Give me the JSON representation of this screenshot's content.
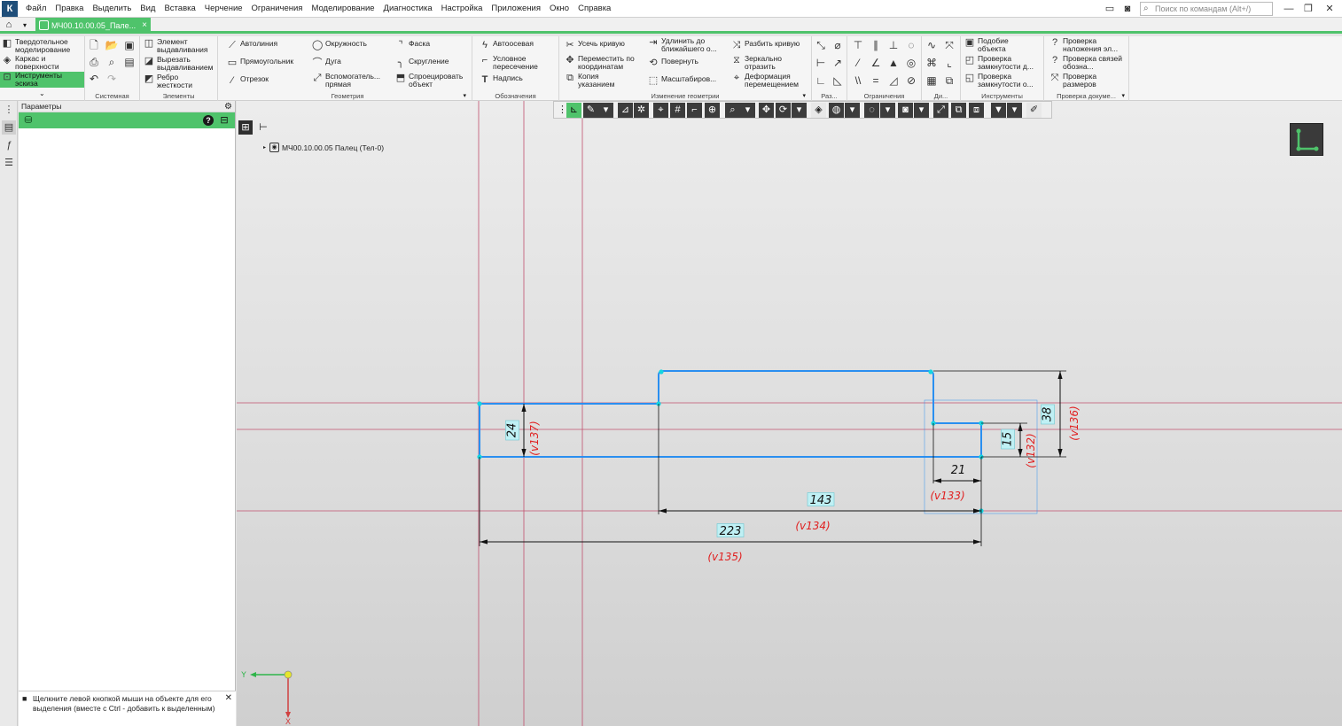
{
  "menu": {
    "logo": "К",
    "items": [
      "Файл",
      "Правка",
      "Выделить",
      "Вид",
      "Вставка",
      "Черчение",
      "Ограничения",
      "Моделирование",
      "Диагностика",
      "Настройка",
      "Приложения",
      "Окно",
      "Справка"
    ],
    "search_placeholder": "Поиск по командам (Alt+/)"
  },
  "tabs": {
    "doc_label": "МЧ00.10.00.05_Пале...",
    "close": "×"
  },
  "ribbon": {
    "left_modes": [
      "Твердотельное моделирование",
      "Каркас и поверхности",
      "Инструменты эскиза"
    ],
    "groups": {
      "system": "Системная",
      "elements": "Элементы",
      "geometry": "Геометрия",
      "designations": "Обозначения",
      "edit_geometry": "Изменение геометрии",
      "dimensions": "Раз...",
      "constraints": "Ограничения",
      "di": "Ди...",
      "tools": "Инструменты",
      "check_doc": "Проверка докуме..."
    },
    "elements": [
      "Элемент выдавливания",
      "Вырезать выдавливанием",
      "Ребро жесткости"
    ],
    "geometry": [
      "Автолиния",
      "Окружность",
      "Фаска",
      "Прямоугольник",
      "Дуга",
      "Скругление",
      "Отрезок",
      "Вспомогатель... прямая",
      "Спроецировать объект"
    ],
    "designations": [
      "Автоосевая",
      "Условное пересечение",
      "Надпись"
    ],
    "edit_geometry": [
      "Усечь кривую",
      "Удлинить до ближайшего о...",
      "Разбить кривую",
      "Переместить по координатам",
      "Повернуть",
      "Зеркально отразить",
      "Копия указанием",
      "Масштабиров...",
      "Деформация перемещением"
    ],
    "tools": [
      "Подобие объекта",
      "Проверка замкнутости д...",
      "Проверка замкнутости о..."
    ],
    "check_doc": [
      "Проверка наложения эл...",
      "Проверка связей обозна...",
      "Проверка размеров"
    ]
  },
  "panel": {
    "title": "Параметры",
    "help": "?",
    "hint": "Щелкните левой кнопкой мыши на объекте для его выделения (вместе с Ctrl - добавить к выделенным)"
  },
  "tree": {
    "root": "МЧ00.10.00.05 Палец (Тел-0)"
  },
  "sketch": {
    "dimensions": [
      {
        "value": "24",
        "var": "(v137)"
      },
      {
        "value": "38",
        "var": "(v136)"
      },
      {
        "value": "15",
        "var": "(v132)"
      },
      {
        "value": "21",
        "var": "(v133)"
      },
      {
        "value": "143",
        "var": "(v134)"
      },
      {
        "value": "223",
        "var": "(v135)"
      }
    ],
    "axis_x": "X",
    "axis_y": "Y",
    "colors": {
      "contour": "#2a8ff0",
      "axes": "#c0506e",
      "dim": "#111111",
      "var": "#e02020",
      "accent": "#4fc36b"
    }
  }
}
